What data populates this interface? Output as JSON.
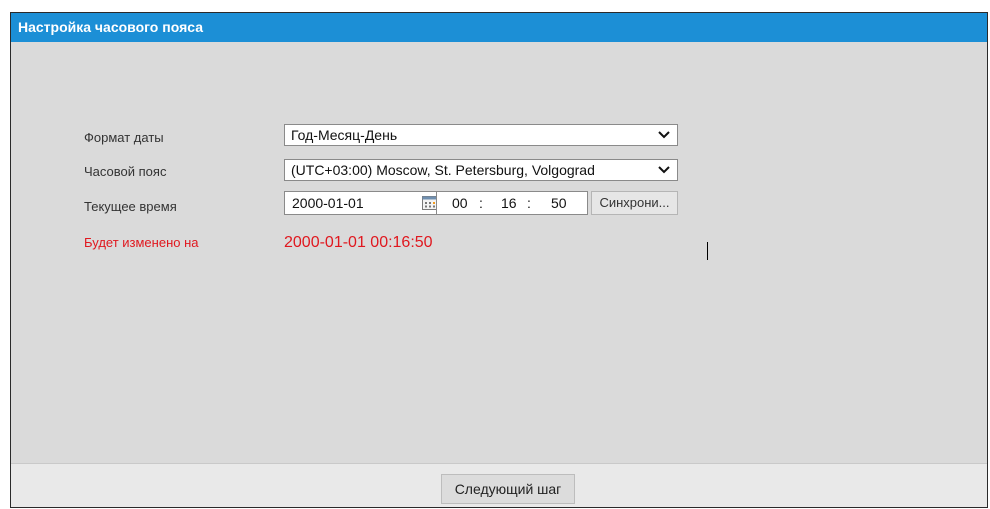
{
  "dialog": {
    "title": "Настройка часового пояса"
  },
  "form": {
    "date_format": {
      "label": "Формат даты",
      "value": "Год-Месяц-День"
    },
    "time_zone": {
      "label": "Часовой пояс",
      "value": "(UTC+03:00) Moscow, St. Petersburg, Volgograd"
    },
    "current_time": {
      "label": "Текущее время",
      "date": "2000-01-01",
      "hours": "00",
      "minutes": "16",
      "seconds": "50",
      "separator": ":",
      "sync_label": "Синхрони..."
    },
    "will_change": {
      "label": "Будет изменено на",
      "value": "2000-01-01 00:16:50"
    }
  },
  "footer": {
    "next_label": "Следующий шаг"
  },
  "colors": {
    "title_bar": "#1c8fd6",
    "panel_bg": "#dadada",
    "highlight_text": "#e0181f"
  }
}
